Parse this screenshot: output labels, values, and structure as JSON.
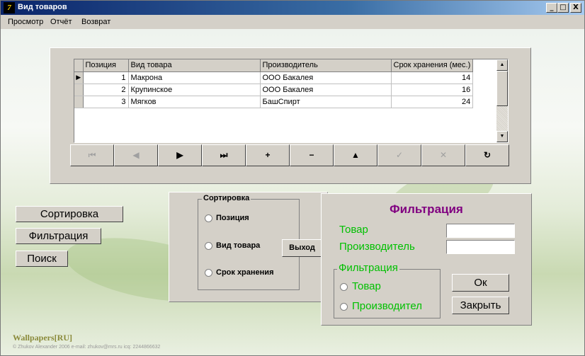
{
  "window": {
    "title": "Вид товаров",
    "app_icon": "delphi-7-icon",
    "controls": [
      "_",
      "□",
      "X"
    ]
  },
  "menu": [
    "Просмотр",
    "Отчёт",
    "Возврат"
  ],
  "grid": {
    "columns": [
      "Позиция",
      "Вид товара",
      "Производитель",
      "Срок хранения (мес.)"
    ],
    "rows": [
      [
        "1",
        "Макрона",
        "ООО Бакалея",
        "14"
      ],
      [
        "2",
        "Крупинское",
        "ООО Бакалея",
        "16"
      ],
      [
        "3",
        "Мягков",
        "БашСпирт",
        "24"
      ]
    ],
    "current_row_indicator": "▶"
  },
  "navigator": [
    {
      "name": "nav-first-button",
      "glyph": "⏮",
      "enabled": false
    },
    {
      "name": "nav-prior-button",
      "glyph": "◀",
      "enabled": false
    },
    {
      "name": "nav-next-button",
      "glyph": "▶",
      "enabled": true
    },
    {
      "name": "nav-last-button",
      "glyph": "⏭",
      "enabled": true
    },
    {
      "name": "nav-insert-button",
      "glyph": "+",
      "enabled": true
    },
    {
      "name": "nav-delete-button",
      "glyph": "−",
      "enabled": true
    },
    {
      "name": "nav-edit-button",
      "glyph": "▲",
      "enabled": true
    },
    {
      "name": "nav-post-button",
      "glyph": "✓",
      "enabled": false
    },
    {
      "name": "nav-cancel-button",
      "glyph": "✕",
      "enabled": false
    },
    {
      "name": "nav-refresh-button",
      "glyph": "↻",
      "enabled": true
    }
  ],
  "left_buttons": {
    "sort": "Сортировка",
    "filter": "Фильтрация",
    "search": "Поиск"
  },
  "sort_panel": {
    "group_caption": "Сортировка",
    "options": [
      "Позиция",
      "Вид товара",
      "Срок хранения"
    ],
    "exit_button": "Выход"
  },
  "filter_panel": {
    "title": "Фильтрация",
    "product_label": "Товар",
    "product_value": "",
    "maker_label": "Производитель",
    "maker_value": "",
    "group_caption": "Фильтрация",
    "options": [
      "Товар",
      "Производител"
    ],
    "ok_button": "Ок",
    "close_button": "Закрыть"
  },
  "footer": {
    "brand": "Wallpapers[RU]",
    "credit": "© Zhukov Alexander 2006 e-mail: zhukov@mrs.ru icq: 2244866632"
  },
  "colors": {
    "title_purple": "#800080",
    "label_green": "#00c000",
    "window_face": "#d4d0c8",
    "titlebar": "#0a246a"
  }
}
